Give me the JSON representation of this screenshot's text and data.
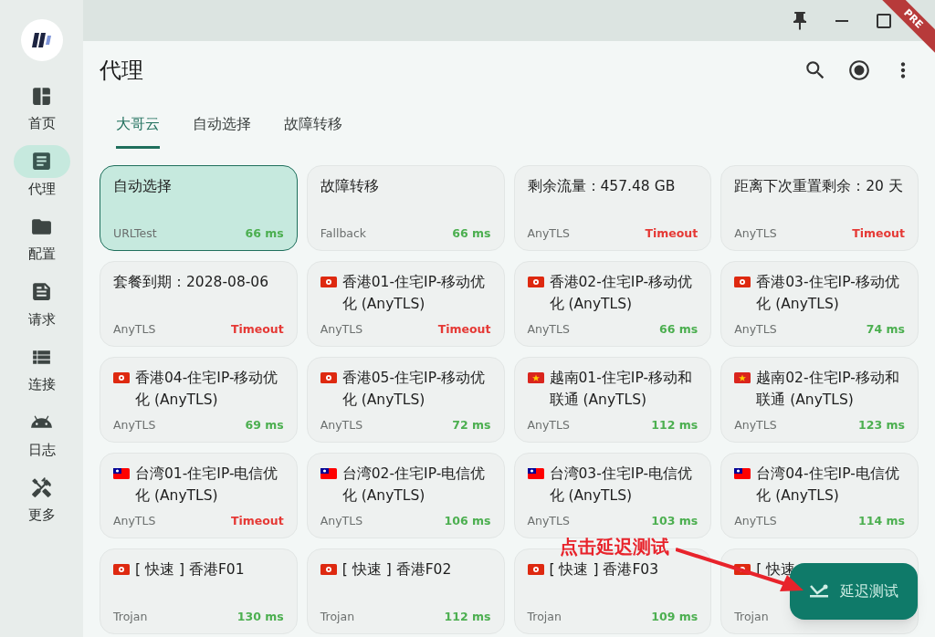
{
  "sidebar": {
    "items": [
      {
        "label": "首页",
        "kind": "dashboard",
        "selected": false
      },
      {
        "label": "代理",
        "kind": "proxy",
        "selected": true
      },
      {
        "label": "配置",
        "kind": "folder",
        "selected": false
      },
      {
        "label": "请求",
        "kind": "request",
        "selected": false
      },
      {
        "label": "连接",
        "kind": "connection",
        "selected": false
      },
      {
        "label": "日志",
        "kind": "log",
        "selected": false
      },
      {
        "label": "更多",
        "kind": "tools",
        "selected": false
      }
    ]
  },
  "badge": "PRE",
  "page_title": "代理",
  "tabs": [
    {
      "label": "大哥云",
      "selected": true
    },
    {
      "label": "自动选择",
      "selected": false
    },
    {
      "label": "故障转移",
      "selected": false
    }
  ],
  "cards": [
    {
      "title": "自动选择",
      "protocol": "URLTest",
      "delay": "66 ms",
      "color": "#4caf50",
      "selected": true
    },
    {
      "title": "故障转移",
      "protocol": "Fallback",
      "delay": "66 ms",
      "color": "#4caf50",
      "selected": false
    },
    {
      "title": "剩余流量：457.48 GB",
      "protocol": "AnyTLS",
      "delay": "Timeout",
      "color": "#e53935",
      "selected": false
    },
    {
      "title": "距离下次重置剩余：20 天",
      "protocol": "AnyTLS",
      "delay": "Timeout",
      "color": "#e53935",
      "selected": false
    },
    {
      "title": "套餐到期：2028-08-06",
      "protocol": "AnyTLS",
      "delay": "Timeout",
      "color": "#e53935",
      "selected": false
    },
    {
      "kind": "hk",
      "title": "香港01-住宅IP-移动优化 (AnyTLS)",
      "protocol": "AnyTLS",
      "delay": "Timeout",
      "color": "#e53935",
      "selected": false
    },
    {
      "kind": "hk",
      "title": "香港02-住宅IP-移动优化 (AnyTLS)",
      "protocol": "AnyTLS",
      "delay": "66 ms",
      "color": "#4caf50",
      "selected": false
    },
    {
      "kind": "hk",
      "title": "香港03-住宅IP-移动优化 (AnyTLS)",
      "protocol": "AnyTLS",
      "delay": "74 ms",
      "color": "#4caf50",
      "selected": false
    },
    {
      "kind": "hk",
      "title": "香港04-住宅IP-移动优化 (AnyTLS)",
      "protocol": "AnyTLS",
      "delay": "69 ms",
      "color": "#4caf50",
      "selected": false
    },
    {
      "kind": "hk",
      "title": "香港05-住宅IP-移动优化 (AnyTLS)",
      "protocol": "AnyTLS",
      "delay": "72 ms",
      "color": "#4caf50",
      "selected": false
    },
    {
      "kind": "vn",
      "title": "越南01-住宅IP-移动和联通 (AnyTLS)",
      "protocol": "AnyTLS",
      "delay": "112 ms",
      "color": "#4caf50",
      "selected": false
    },
    {
      "kind": "vn",
      "title": "越南02-住宅IP-移动和联通 (AnyTLS)",
      "protocol": "AnyTLS",
      "delay": "123 ms",
      "color": "#4caf50",
      "selected": false
    },
    {
      "kind": "tw",
      "title": "台湾01-住宅IP-电信优化 (AnyTLS)",
      "protocol": "AnyTLS",
      "delay": "Timeout",
      "color": "#e53935",
      "selected": false
    },
    {
      "kind": "tw",
      "title": "台湾02-住宅IP-电信优化 (AnyTLS)",
      "protocol": "AnyTLS",
      "delay": "106 ms",
      "color": "#4caf50",
      "selected": false
    },
    {
      "kind": "tw",
      "title": "台湾03-住宅IP-电信优化 (AnyTLS)",
      "protocol": "AnyTLS",
      "delay": "103 ms",
      "color": "#4caf50",
      "selected": false
    },
    {
      "kind": "tw",
      "title": "台湾04-住宅IP-电信优化 (AnyTLS)",
      "protocol": "AnyTLS",
      "delay": "114 ms",
      "color": "#4caf50",
      "selected": false
    },
    {
      "kind": "hk",
      "title": "[ 快速 ] 香港F01",
      "protocol": "Trojan",
      "delay": "130 ms",
      "color": "#4caf50",
      "selected": false
    },
    {
      "kind": "hk",
      "title": "[ 快速 ] 香港F02",
      "protocol": "Trojan",
      "delay": "112 ms",
      "color": "#4caf50",
      "selected": false
    },
    {
      "kind": "hk",
      "title": "[ 快速 ] 香港F03",
      "protocol": "Trojan",
      "delay": "109 ms",
      "color": "#4caf50",
      "selected": false
    },
    {
      "kind": "hk",
      "title": "[ 快速",
      "protocol": "Trojan",
      "selected": false
    }
  ],
  "fab": {
    "label": "延迟测试"
  },
  "annotation": "点击延迟测试"
}
